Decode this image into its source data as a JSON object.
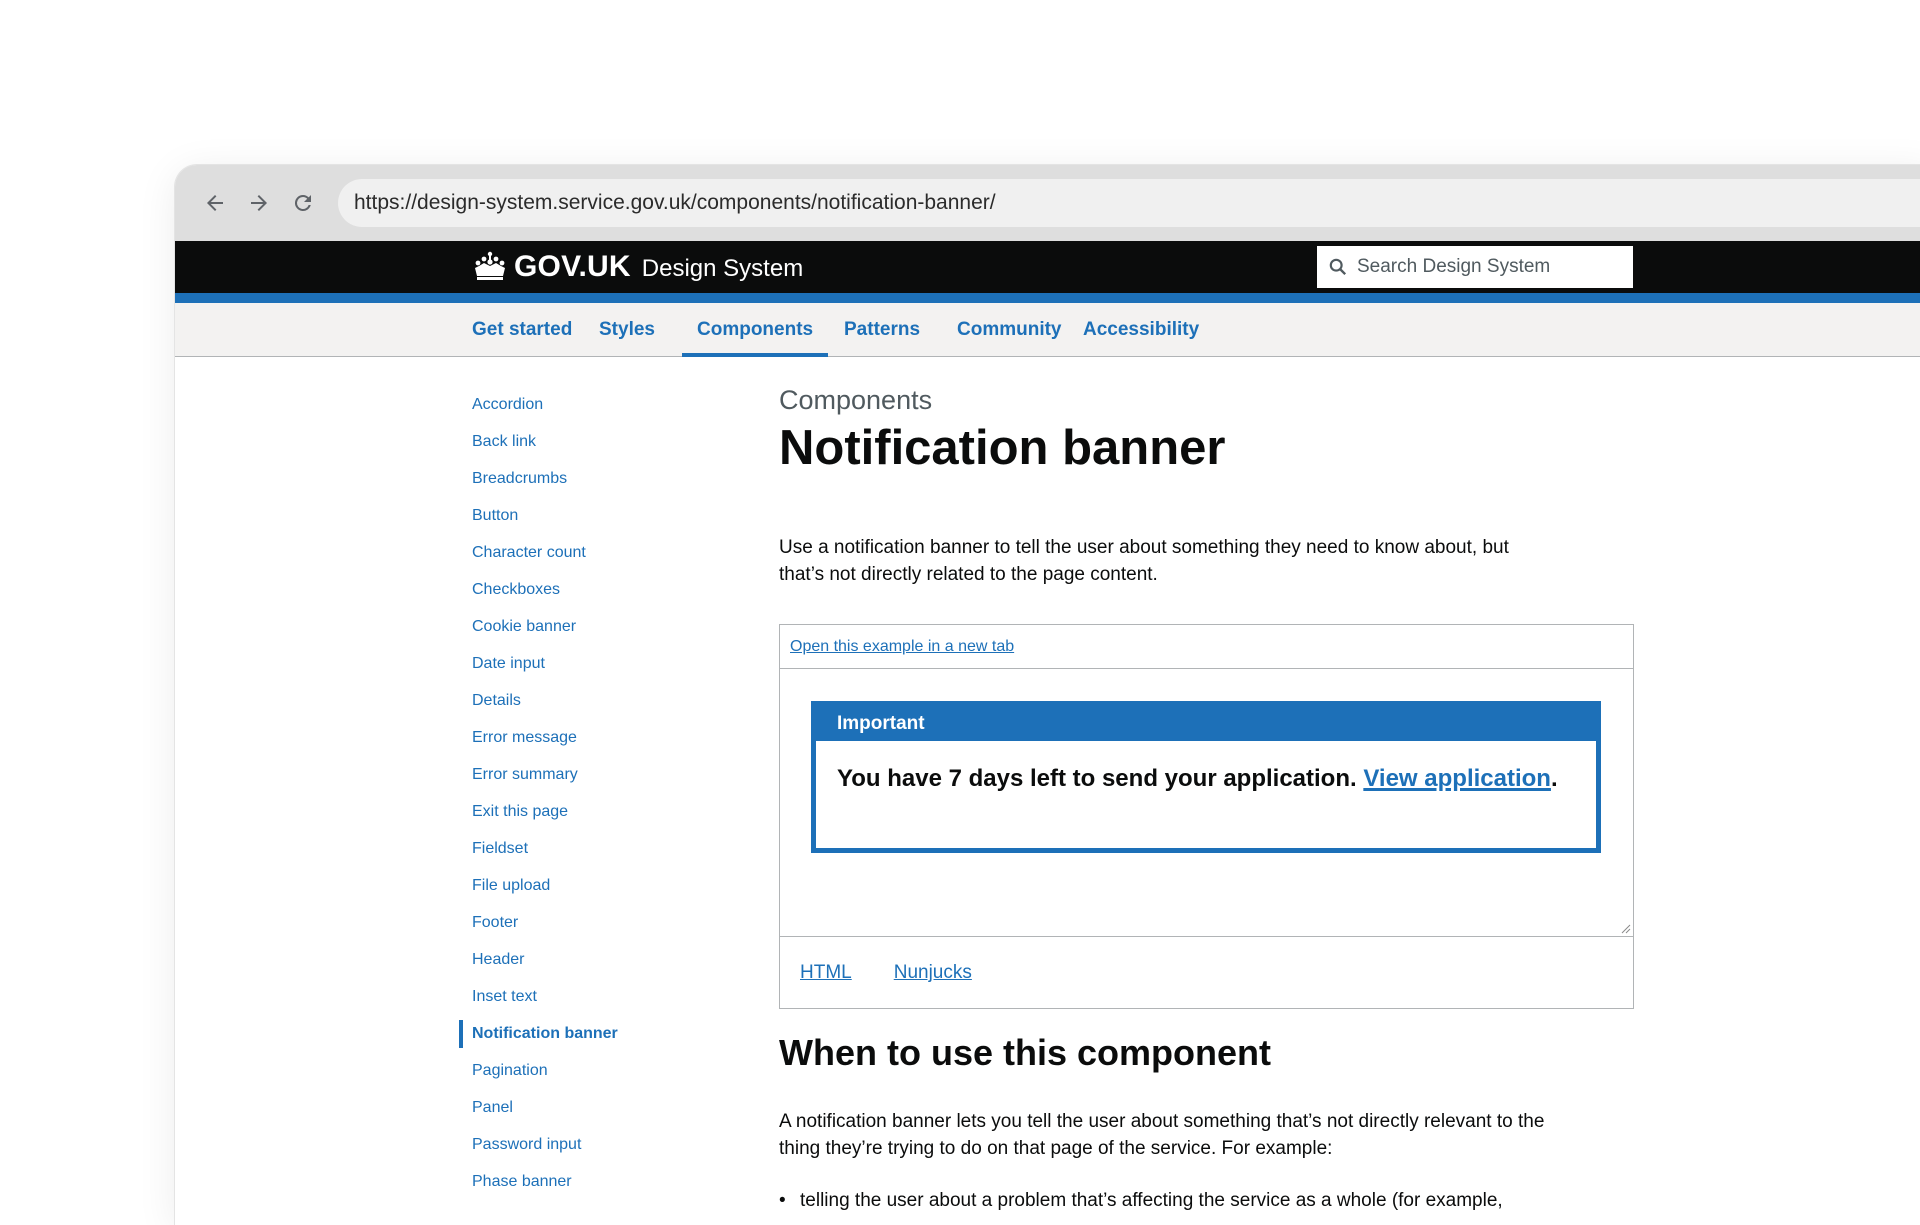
{
  "browser": {
    "url": "https://design-system.service.gov.uk/components/notification-banner/"
  },
  "header": {
    "brand": "GOV.UK",
    "product": "Design System",
    "search_placeholder": "Search Design System"
  },
  "topnav": {
    "items": [
      {
        "label": "Get started"
      },
      {
        "label": "Styles"
      },
      {
        "label": "Components"
      },
      {
        "label": "Patterns"
      },
      {
        "label": "Community"
      },
      {
        "label": "Accessibility"
      }
    ],
    "active": "Components"
  },
  "sidenav": {
    "items": [
      {
        "label": "Accordion"
      },
      {
        "label": "Back link"
      },
      {
        "label": "Breadcrumbs"
      },
      {
        "label": "Button"
      },
      {
        "label": "Character count"
      },
      {
        "label": "Checkboxes"
      },
      {
        "label": "Cookie banner"
      },
      {
        "label": "Date input"
      },
      {
        "label": "Details"
      },
      {
        "label": "Error message"
      },
      {
        "label": "Error summary"
      },
      {
        "label": "Exit this page"
      },
      {
        "label": "Fieldset"
      },
      {
        "label": "File upload"
      },
      {
        "label": "Footer"
      },
      {
        "label": "Header"
      },
      {
        "label": "Inset text"
      },
      {
        "label": "Notification banner"
      },
      {
        "label": "Pagination"
      },
      {
        "label": "Panel"
      },
      {
        "label": "Password input"
      },
      {
        "label": "Phase banner"
      }
    ],
    "active": "Notification banner"
  },
  "main": {
    "caption": "Components",
    "title": "Notification banner",
    "lead": "Use a notification banner to tell the user about something they need to know about, but that’s not directly related to the page content.",
    "example": {
      "open_link": "Open this example in a new tab",
      "banner_title": "Important",
      "banner_text": "You have 7 days left to send your application.",
      "banner_link": "View application",
      "banner_end": ".",
      "code_tabs": [
        {
          "label": "HTML"
        },
        {
          "label": "Nunjucks"
        }
      ]
    },
    "section_heading": "When to use this component",
    "section_body": "A notification banner lets you tell the user about something that’s not directly relevant to the thing they’re trying to do on that page of the service. For example:",
    "bullet": "telling the user about a problem that’s affecting the service as a whole (for example,"
  },
  "colors": {
    "govuk_blue": "#1d70b8",
    "govuk_black": "#0b0c0c",
    "nav_bg": "#f3f2f1",
    "secondary_text": "#505a5f"
  }
}
